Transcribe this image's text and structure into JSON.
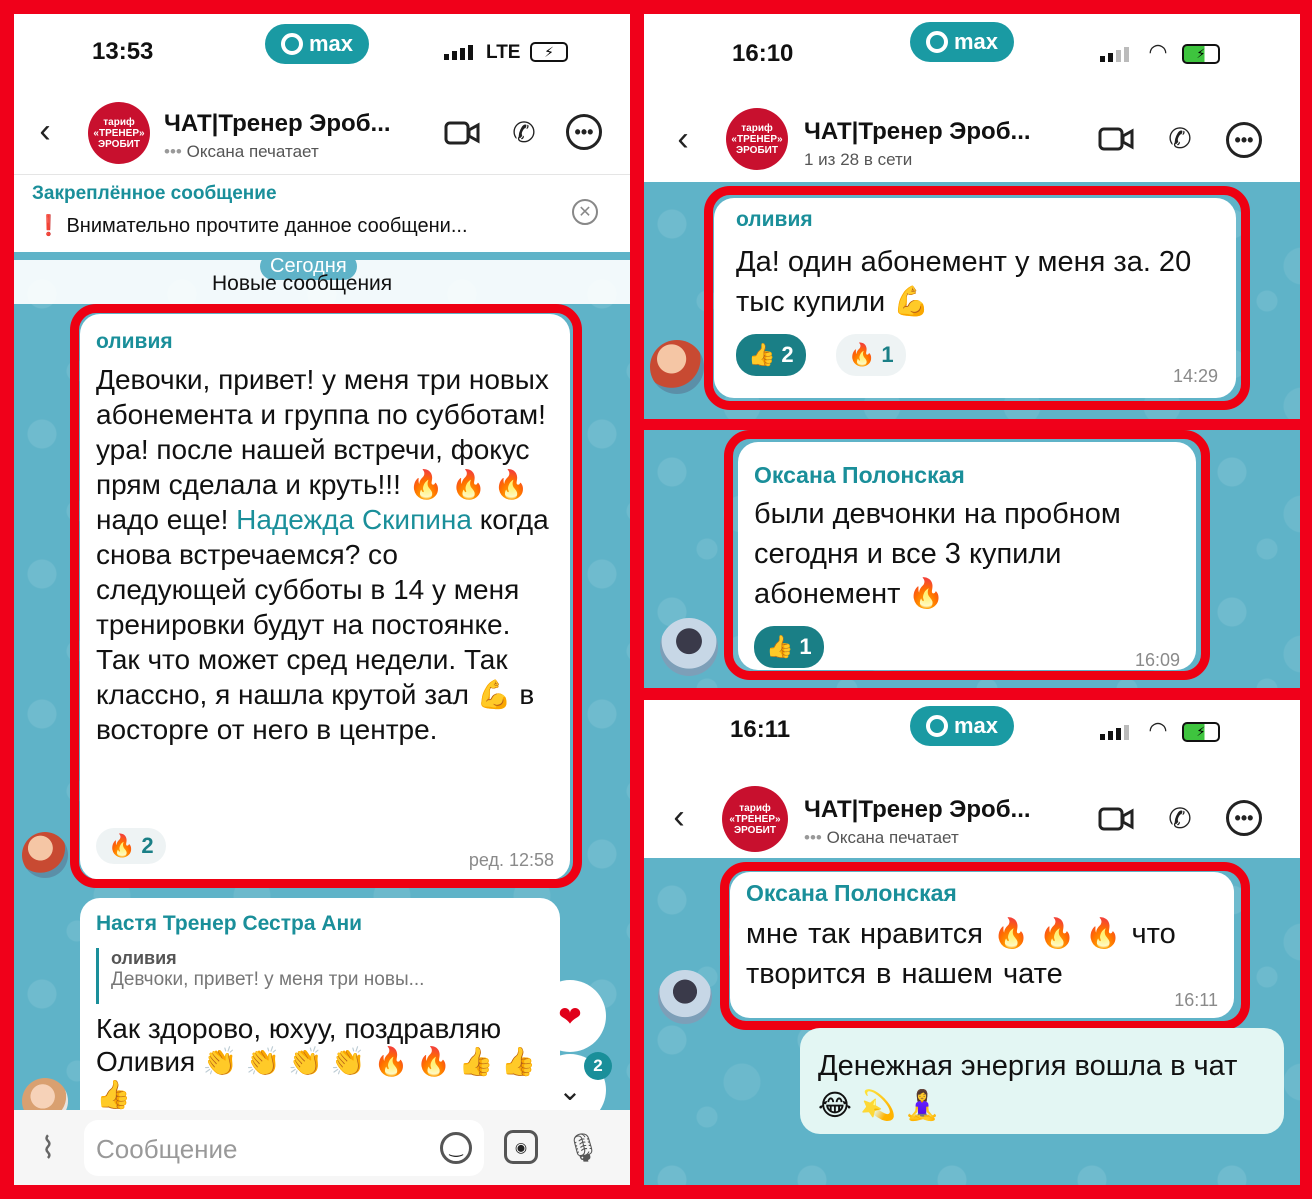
{
  "screen1": {
    "time": "13:53",
    "app_pill": "max",
    "network": "LTE",
    "chat_title": "ЧАТ|Тренер Эроб...",
    "chat_status": "Оксана печатает",
    "logo_text": "тариф «ТРЕНЕР» ЭРОБИТ",
    "pinned_title": "Закреплённое сообщение",
    "pinned_text": "Внимательно прочтите данное сообщени...",
    "date_chip": "Сегодня",
    "new_messages": "Новые сообщения",
    "msg1": {
      "author": "оливия",
      "text_before": "Девочки, привет! у меня три новых абонемента и группа по субботам! ура! после нашей встречи, фокус прям сделала и круть!!! 🔥 🔥 🔥 надо еще! ",
      "mention": "Надежда Скипина",
      "text_after": " когда снова встречаемся? со следующей субботы в 14 у меня тренировки будут на постоянке. Так что может сред недели. Так классно, я нашла крутой зал 💪 в восторге от него в центре.",
      "reaction_emoji": "🔥",
      "reaction_count": "2",
      "time": "ред. 12:58"
    },
    "msg2": {
      "author": "Настя Тренер Сестра Ани",
      "reply_author": "оливия",
      "reply_text": "Девчоки, привет! у меня три новы...",
      "text": "Как здорово, юхуу, поздравляю Оливия 👏 👏 👏 👏 🔥 🔥 👍 👍 👍"
    },
    "fab_heart": "❤",
    "unread_count": "2",
    "input_placeholder": "Сообщение"
  },
  "screen2": {
    "time": "16:10",
    "app_pill": "max",
    "chat_title": "ЧАТ|Тренер Эроб...",
    "chat_status": "1 из 28 в сети",
    "logo_text": "тариф «ТРЕНЕР» ЭРОБИТ",
    "msg1": {
      "author": "оливия",
      "text": "Да! один абонемент у меня за. 20 тыс купили 💪",
      "reaction1_emoji": "👍",
      "reaction1_count": "2",
      "reaction2_emoji": "🔥",
      "reaction2_count": "1",
      "time": "14:29"
    },
    "msg2": {
      "author": "Оксана Полонская",
      "text": "были девчонки на пробном сегодня и все 3 купили абонемент 🔥",
      "reaction_emoji": "👍",
      "reaction_count": "1",
      "time": "16:09"
    }
  },
  "screen3": {
    "time": "16:11",
    "app_pill": "max",
    "chat_title": "ЧАТ|Тренер Эроб...",
    "chat_status": "Оксана печатает",
    "logo_text": "тариф «ТРЕНЕР» ЭРОБИТ",
    "msg1": {
      "author": "Оксана Полонская",
      "text": "мне так нравится 🔥 🔥 🔥  что творится в нашем чате",
      "time": "16:11"
    },
    "msg2": {
      "text": "Денежная энергия вошла в чат 😂 💫 🧘‍♀️"
    }
  }
}
